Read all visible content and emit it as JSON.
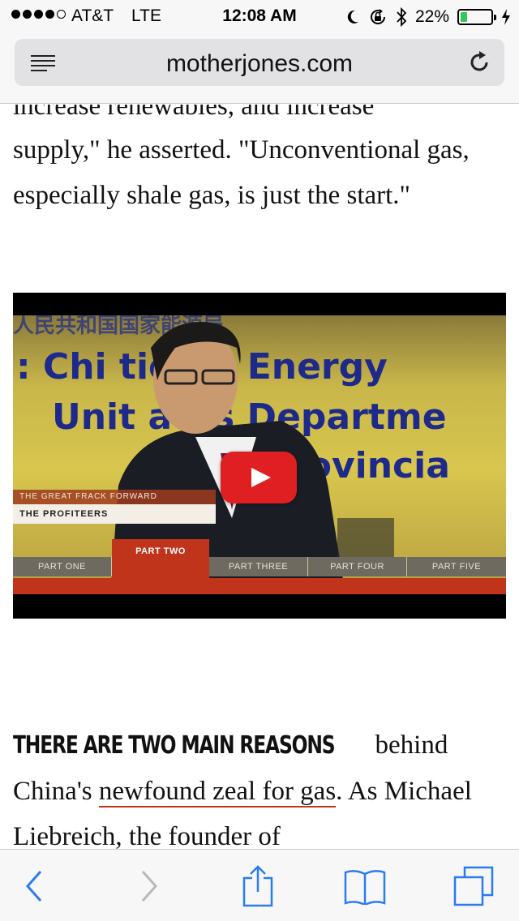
{
  "status_bar": {
    "carrier": "AT&T",
    "network": "LTE",
    "time": "12:08 AM",
    "battery_percent": "22%",
    "battery_level": 0.22,
    "icons": [
      "signal-dots-icon",
      "moon-icon",
      "rotation-lock-icon",
      "bluetooth-icon",
      "battery-icon",
      "charging-bolt-icon"
    ]
  },
  "address_bar": {
    "url": "motherjones.com",
    "left_icon": "reader-list-icon",
    "right_icon": "reload-icon"
  },
  "article": {
    "cutoff_line": "increase renewables, and increase",
    "paragraph1": "supply,\" he asserted. \"Unconventional gas, especially shale gas, is just the start.\"",
    "paragraph2": {
      "lead_in": "THERE ARE TWO MAIN REASONS",
      "text_before_link": " behind China's ",
      "link_text": "newfound zeal for gas",
      "text_after_link": ". As Michael Liebreich, the founder of"
    }
  },
  "video": {
    "banner_lines": [
      "人民共和国国家能源局",
      ": Chi       tional Energy",
      "Unit     ates Departme",
      "xi Provincia"
    ],
    "show_title": "THE GREAT FRACK FORWARD",
    "episode_title": "THE PROFITEERS",
    "parts": [
      "PART ONE",
      "PART TWO",
      "PART THREE",
      "PART FOUR",
      "PART FIVE"
    ],
    "active_part": "PART TWO",
    "play_icon": "youtube-play-icon"
  },
  "toolbar": {
    "buttons": [
      "back-icon",
      "forward-icon",
      "share-icon",
      "bookmarks-icon",
      "tabs-icon"
    ],
    "accent_color": "#2a7cf0",
    "disabled_color": "#b8b8bc"
  }
}
